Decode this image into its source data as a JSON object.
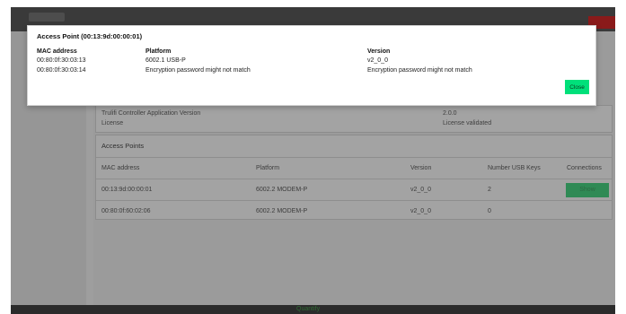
{
  "app": {
    "footer_text": "Quantify"
  },
  "controller_info": {
    "rows": [
      {
        "label": "Trulifi Controller Application Version",
        "value": "2.0.0"
      },
      {
        "label": "License",
        "value": "License validated"
      }
    ]
  },
  "access_points": {
    "title": "Access Points",
    "columns": [
      "MAC address",
      "Platform",
      "Version",
      "Number USB Keys",
      "Connections"
    ],
    "rows": [
      {
        "mac": "00:13:9d:00:00:01",
        "platform": "6002.2 MODEM-P",
        "version": "v2_0_0",
        "usb_keys": "2",
        "action": "Show"
      },
      {
        "mac": "00:80:0f:60:02:06",
        "platform": "6002.2 MODEM-P",
        "version": "v2_0_0",
        "usb_keys": "0",
        "action": ""
      }
    ]
  },
  "modal": {
    "title": "Access Point (00:13:9d:00:00:01)",
    "columns": [
      "MAC address",
      "Platform",
      "Version"
    ],
    "rows": [
      {
        "mac": "00:80:0f:30:03:13",
        "platform": "6002.1 USB-P",
        "version": "v2_0_0"
      },
      {
        "mac": "00:80:0f:30:03:14",
        "platform": "Encryption password might not match",
        "version": "Encryption password might not match"
      }
    ],
    "close_label": "Close"
  },
  "colors": {
    "close_button": "#00e07a",
    "show_button": "#2f8a55",
    "header_danger": "#8a1a1a"
  }
}
